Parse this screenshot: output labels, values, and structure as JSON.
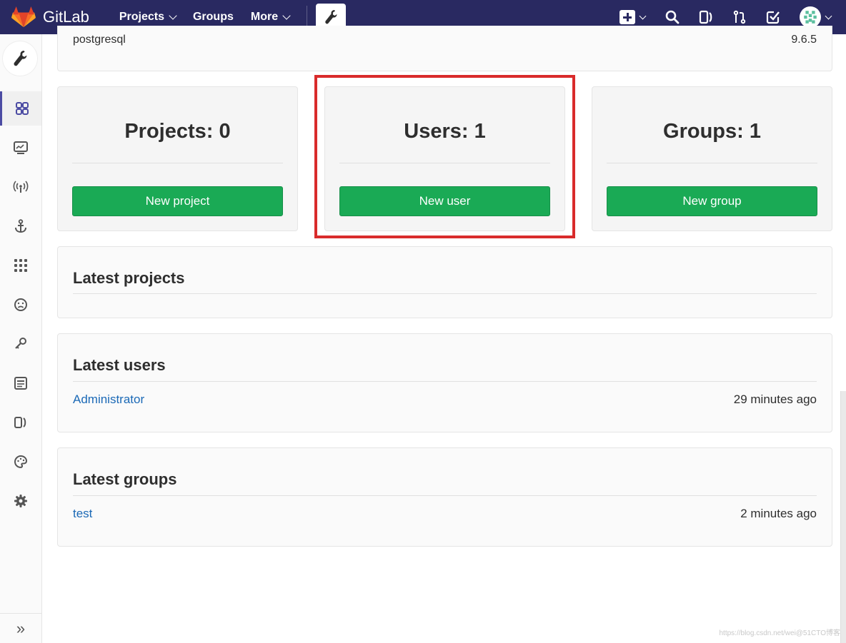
{
  "navbar": {
    "brand": "GitLab",
    "links": [
      {
        "label": "Projects",
        "has_dropdown": true
      },
      {
        "label": "Groups",
        "has_dropdown": false
      },
      {
        "label": "More",
        "has_dropdown": true
      }
    ],
    "right_icons": [
      "new-icon",
      "search-icon",
      "issues-icon",
      "merge-requests-icon",
      "todos-icon",
      "user-avatar"
    ],
    "bg_color": "#292961"
  },
  "sidebar": {
    "top_icon": "wrench-icon",
    "items": [
      "overview-icon",
      "monitoring-icon",
      "messages-icon",
      "hooks-icon",
      "applications-icon",
      "abuse-reports-icon",
      "deploy-keys-icon",
      "service-templates-icon",
      "labels-icon",
      "appearance-icon",
      "settings-icon"
    ],
    "collapse_label": "»",
    "active_index": 0
  },
  "system_info": {
    "key": "postgresql",
    "value": "9.6.5"
  },
  "stats": [
    {
      "title": "Projects: 0",
      "button": "New project"
    },
    {
      "title": "Users: 1",
      "button": "New user"
    },
    {
      "title": "Groups: 1",
      "button": "New group"
    }
  ],
  "latest_projects": {
    "title": "Latest projects"
  },
  "latest_users": {
    "title": "Latest users",
    "items": [
      {
        "name": "Administrator",
        "time": "29 minutes ago"
      }
    ]
  },
  "latest_groups": {
    "title": "Latest groups",
    "items": [
      {
        "name": "test",
        "time": "2 minutes ago"
      }
    ]
  },
  "colors": {
    "button_green": "#1aaa55",
    "link_blue": "#1b69b6",
    "highlight_red": "#d92b2b"
  },
  "watermark": "https://blog.csdn.net/wei@51CTO博客"
}
